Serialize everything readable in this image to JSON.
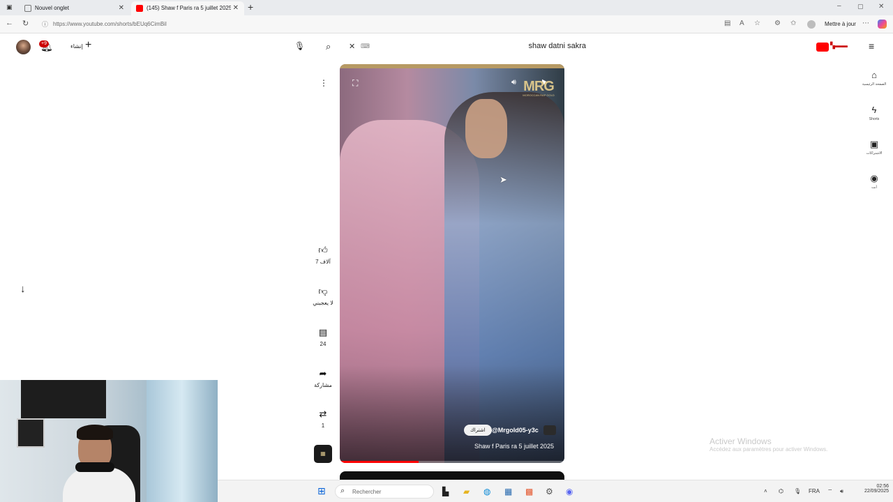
{
  "browser": {
    "tabs": [
      {
        "label": "Nouvel onglet",
        "active": false
      },
      {
        "label": "(145) Shaw f Paris ra 5 juillet 2025",
        "active": true
      }
    ],
    "url": "https://www.youtube.com/shorts/bEUq6CimBil",
    "update_button": "Mettre à jour"
  },
  "youtube": {
    "notifications_badge": "+9",
    "create_label": "إنشاء",
    "search_query": "shaw datni sakra",
    "sidebar": [
      {
        "icon": "home-icon",
        "label": "الصفحة الرئيسية"
      },
      {
        "icon": "shorts-icon",
        "label": "Shorts"
      },
      {
        "icon": "subscriptions-icon",
        "label": "الاشتراكات"
      },
      {
        "icon": "you-icon",
        "label": "أنت"
      }
    ]
  },
  "short": {
    "channel": "@Mrgold05-y3c",
    "subscribe_label": "اشتراك",
    "title": "Shaw f Paris ra 5 juillet 2025",
    "logo_text": "MRG",
    "logo_subtext": "MOROCCAN RAP GOLD",
    "progress": 0.35
  },
  "actions": {
    "likes": "7 آلاف",
    "dislike_label": "لا يعجبني",
    "comments": "24",
    "share_label": "مشاركة",
    "remix_count": "1"
  },
  "watermark": {
    "line1": "Activer Windows",
    "line2": "Accédez aux paramètres pour activer Windows."
  },
  "taskbar": {
    "search_placeholder": "Rechercher",
    "language": "FRA",
    "time": "02:56",
    "date": "22/09/2025"
  }
}
